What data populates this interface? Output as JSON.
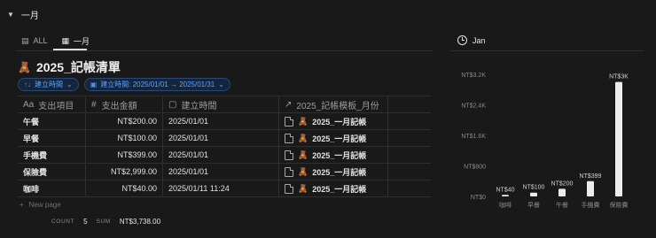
{
  "toggle": {
    "title": "一月"
  },
  "tabs": [
    {
      "label": "ALL",
      "icon": "table-icon",
      "active": false
    },
    {
      "label": "一月",
      "icon": "table-icon",
      "active": true
    }
  ],
  "db": {
    "emoji": "🧸",
    "title": "2025_記帳清單"
  },
  "filters": [
    {
      "label": "建立時間",
      "icon": "sort-icon"
    },
    {
      "label": "建立時間: 2025/01/01 → 2025/01/31",
      "icon": "calendar-icon"
    }
  ],
  "table": {
    "columns": [
      {
        "label": "支出項目",
        "icon": "Aa"
      },
      {
        "label": "支出金額",
        "icon": "#"
      },
      {
        "label": "建立時間",
        "icon": "calendar-icon"
      },
      {
        "label": "2025_記帳模板_月份",
        "icon": "relation-arrow-icon"
      }
    ],
    "rows": [
      {
        "item": "午餐",
        "amount": "NT$200.00",
        "created": "2025/01/01",
        "relation": "2025_一月記帳"
      },
      {
        "item": "早餐",
        "amount": "NT$100.00",
        "created": "2025/01/01",
        "relation": "2025_一月記帳"
      },
      {
        "item": "手機費",
        "amount": "NT$399.00",
        "created": "2025/01/01",
        "relation": "2025_一月記帳"
      },
      {
        "item": "保險費",
        "amount": "NT$2,999.00",
        "created": "2025/01/01",
        "relation": "2025_一月記帳"
      },
      {
        "item": "咖啡",
        "amount": "NT$40.00",
        "created": "2025/01/11 11:24",
        "relation": "2025_一月記帳"
      }
    ],
    "new_page": "New page",
    "footer": {
      "count_label": "COUNT",
      "count_value": "5",
      "sum_label": "SUM",
      "sum_value": "NT$3,738.00"
    }
  },
  "chart_panel": {
    "tab_label": "Jan"
  },
  "colors": {
    "bar": "#ededed",
    "axis_text": "#8b8b8b",
    "label_text": "#cfcfcf",
    "grid": "#2b2b2b"
  },
  "chart_data": {
    "type": "bar",
    "categories": [
      "咖啡",
      "早餐",
      "午餐",
      "手機費",
      "保險費"
    ],
    "values": [
      40,
      100,
      200,
      399,
      3000
    ],
    "value_labels": [
      "NT$40",
      "NT$100",
      "NT$200",
      "NT$399",
      "NT$3K"
    ],
    "ylim": [
      0,
      3200
    ],
    "yticks": [
      0,
      800,
      1600,
      2400,
      3200
    ],
    "ytick_labels": [
      "NT$0",
      "NT$800",
      "NT$1.6K",
      "NT$2.4K",
      "NT$3.2K"
    ],
    "grid": false,
    "title": "",
    "xlabel": "",
    "ylabel": ""
  }
}
